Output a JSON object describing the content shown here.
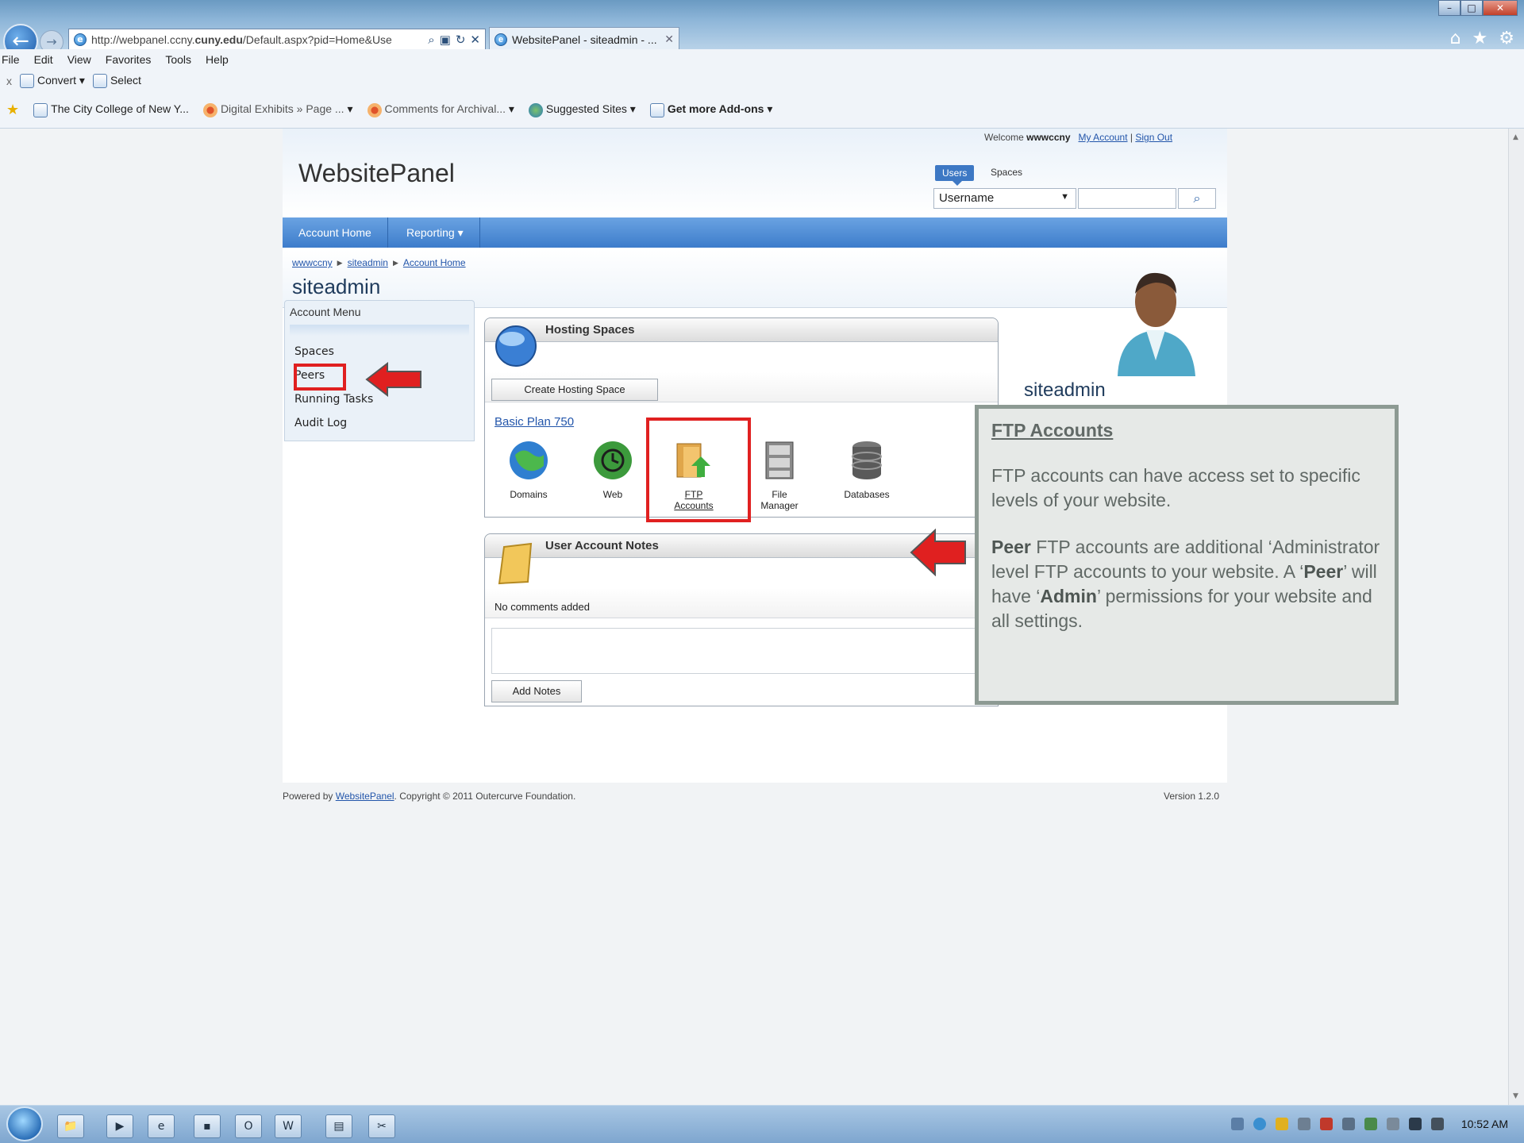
{
  "browser": {
    "url_prefix": "http://webpanel.ccny.",
    "url_bold": "cuny.edu",
    "url_rest": "/Default.aspx?pid=Home&Use",
    "tab_title": "WebsitePanel - siteadmin - ...",
    "menu": [
      "File",
      "Edit",
      "View",
      "Favorites",
      "Tools",
      "Help"
    ],
    "convert": {
      "close": "x",
      "convert_label": "Convert",
      "select_label": "Select"
    },
    "favorites": [
      {
        "label": "The City College of New Y..."
      },
      {
        "label": "Digital Exhibits » Page ...",
        "dropdown": "▾"
      },
      {
        "label": "Comments for Archival...",
        "dropdown": "▾"
      },
      {
        "label": "Suggested Sites",
        "dropdown": "▾"
      },
      {
        "label": "Get more Add-ons",
        "dropdown": "▾"
      }
    ]
  },
  "header": {
    "welcome_prefix": "Welcome",
    "welcome_user": "wwwccny",
    "my_account": "My Account",
    "divider": "|",
    "sign_out": "Sign Out",
    "logo": "WebsitePanel",
    "tab_users": "Users",
    "tab_spaces": "Spaces",
    "search_field": "Username"
  },
  "nav": {
    "account_home": "Account Home",
    "reporting": "Reporting"
  },
  "breadcrumb": [
    "wwwccny",
    "siteadmin",
    "Account Home"
  ],
  "page_title": "siteadmin",
  "account_menu": {
    "header": "Account Menu",
    "items": [
      "Spaces",
      "Peers",
      "Running Tasks",
      "Audit Log"
    ]
  },
  "hosting": {
    "title": "Hosting Spaces",
    "create_button": "Create Hosting Space",
    "plan_link": "Basic Plan 750",
    "services": [
      "Domains",
      "Web",
      "FTP Accounts",
      "File Manager",
      "Databases"
    ]
  },
  "notes": {
    "title": "User Account Notes",
    "empty_text": "No comments added",
    "add_button": "Add Notes"
  },
  "user_card": {
    "name": "siteadmin"
  },
  "callout": {
    "title": "FTP Accounts",
    "para1": "FTP accounts can have access set to specific levels of your website.",
    "para2_bold1": "Peer",
    "para2_a": " FTP accounts are additional ‘Administrator level FTP accounts to your website. A ‘",
    "para2_bold2": "Peer",
    "para2_b": "’ will have ‘",
    "para2_bold3": "Admin",
    "para2_c": "’ permissions for your website and all settings."
  },
  "footer": {
    "powered_prefix": "Powered by",
    "powered_link": "WebsitePanel",
    "powered_suffix": ". Copyright © 2011 Outercurve Foundation.",
    "version": "Version 1.2.0"
  },
  "taskbar": {
    "clock": "10:52 AM"
  },
  "colors": {
    "accent_blue": "#3d7ccb",
    "highlight_red": "#e02020",
    "callout_bg": "#e6e9e7"
  }
}
